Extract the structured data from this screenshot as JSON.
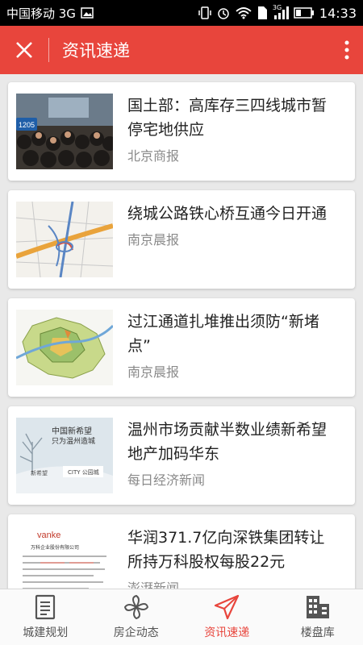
{
  "status_bar": {
    "carrier": "中国移动 3G",
    "network": "3G",
    "time": "14:33"
  },
  "app_bar": {
    "title": "资讯速递"
  },
  "articles": [
    {
      "headline": "国土部：高库存三四线城市暂停宅地供应",
      "source": "北京商报",
      "thumb_icon": "conference-photo",
      "thumb_badge": "1205"
    },
    {
      "headline": "绕城公路铁心桥互通今日开通",
      "source": "南京晨报",
      "thumb_icon": "road-map"
    },
    {
      "headline": "过江通道扎堆推出须防“新堵点”",
      "source": "南京晨报",
      "thumb_icon": "district-map"
    },
    {
      "headline": "温州市场贡献半数业绩新希望地产加码华东",
      "source": "每日经济新闻",
      "thumb_icon": "advert-poster",
      "thumb_text_1": "中国新希望",
      "thumb_text_2": "只为温州造城",
      "thumb_text_3": "新希望",
      "thumb_text_4": "CITY 公园城"
    },
    {
      "headline": "华润371.7亿向深铁集团转让所持万科股权每股22元",
      "source": "澎湃新闻",
      "thumb_icon": "document-scan",
      "thumb_text_1": "vanke",
      "thumb_text_2": "万科企业股份有限公司"
    }
  ],
  "tabs": [
    {
      "label": "城建规划",
      "icon": "document-icon",
      "active": false
    },
    {
      "label": "房企动态",
      "icon": "pinwheel-icon",
      "active": false
    },
    {
      "label": "资讯速递",
      "icon": "paper-plane-icon",
      "active": true
    },
    {
      "label": "楼盘库",
      "icon": "building-icon",
      "active": false
    }
  ],
  "colors": {
    "accent": "#e8453c",
    "status_bar": "#000000",
    "background": "#e9e9e9"
  }
}
